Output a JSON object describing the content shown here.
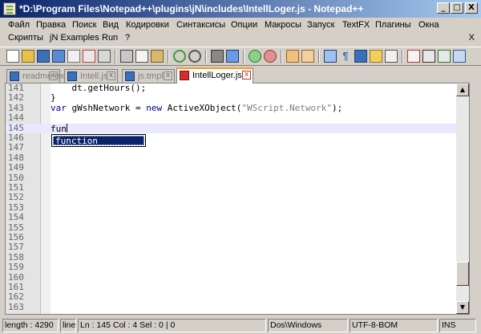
{
  "window": {
    "title": "*D:\\Program Files\\Notepad++\\plugins\\jN\\includes\\IntellLoger.js - Notepad++",
    "minimize": "_",
    "maximize": "□",
    "close": "X"
  },
  "menu": {
    "row1": [
      "Файл",
      "Правка",
      "Поиск",
      "Вид",
      "Кодировки",
      "Синтаксисы",
      "Опции",
      "Макросы",
      "Запуск",
      "TextFX",
      "Плагины",
      "Окна"
    ],
    "row2": [
      "Скрипты",
      "jN Examples",
      "Run",
      "?"
    ],
    "close": "X"
  },
  "tabs": [
    {
      "label": "readme.md",
      "active": false
    },
    {
      "label": "Intell.js",
      "active": false
    },
    {
      "label": "js.tmpl",
      "active": false
    },
    {
      "label": "IntellLoger.js",
      "active": true
    }
  ],
  "tab_close": "x",
  "editor": {
    "lines": [
      {
        "num": "141",
        "code": "    dt.getHours();"
      },
      {
        "num": "142",
        "code": "}"
      },
      {
        "num": "143",
        "code": "var gWshNetwork = new ActiveXObject(\"WScript.Network\");"
      },
      {
        "num": "144",
        "code": ""
      },
      {
        "num": "145",
        "code": "fun"
      },
      {
        "num": "146",
        "code": ""
      },
      {
        "num": "147",
        "code": ""
      },
      {
        "num": "148",
        "code": ""
      },
      {
        "num": "149",
        "code": ""
      },
      {
        "num": "150",
        "code": ""
      },
      {
        "num": "151",
        "code": ""
      },
      {
        "num": "152",
        "code": ""
      },
      {
        "num": "153",
        "code": ""
      },
      {
        "num": "154",
        "code": ""
      },
      {
        "num": "155",
        "code": ""
      },
      {
        "num": "156",
        "code": ""
      },
      {
        "num": "157",
        "code": ""
      },
      {
        "num": "158",
        "code": ""
      },
      {
        "num": "159",
        "code": ""
      },
      {
        "num": "160",
        "code": ""
      },
      {
        "num": "161",
        "code": ""
      },
      {
        "num": "162",
        "code": ""
      },
      {
        "num": "163",
        "code": ""
      }
    ],
    "current_line": "145",
    "autocomplete": {
      "selected": "function"
    },
    "scroll_up": "▲",
    "scroll_down": "▼"
  },
  "status": {
    "length": "length : 4290",
    "lines": "line",
    "position": "Ln : 145   Col : 4   Sel : 0 | 0",
    "eol": "Dos\\Windows",
    "encoding": "UTF-8-BOM",
    "mode": "INS"
  },
  "colors": {
    "keyword": "#00007f",
    "string": "#7f7f7f",
    "current_line": "#e8e8ff",
    "active_tab_accent": "#f59d2a"
  }
}
